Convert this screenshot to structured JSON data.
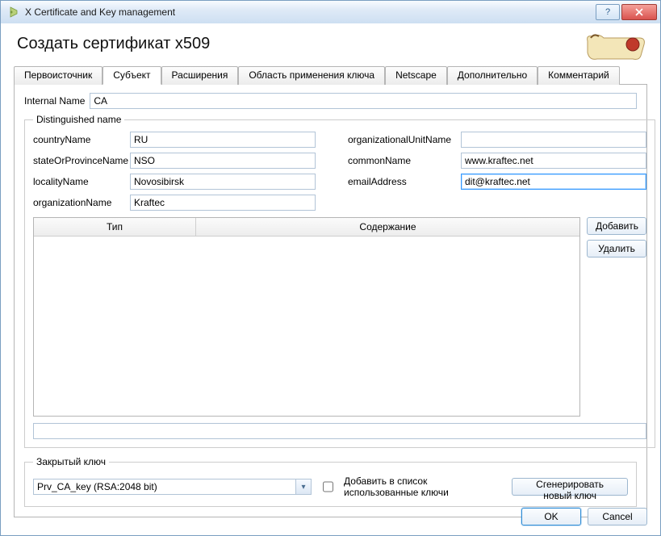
{
  "window": {
    "title": "X Certificate and Key management"
  },
  "page": {
    "title": "Создать сертификат x509"
  },
  "tabs": [
    {
      "label": "Первоисточник"
    },
    {
      "label": "Субъект"
    },
    {
      "label": "Расширения"
    },
    {
      "label": "Область применения ключа"
    },
    {
      "label": "Netscape"
    },
    {
      "label": "Дополнительно"
    },
    {
      "label": "Комментарий"
    }
  ],
  "internal": {
    "label": "Internal Name",
    "value": "CA"
  },
  "dn": {
    "legend": "Distinguished name",
    "countryName": {
      "label": "countryName",
      "value": "RU"
    },
    "stateOrProvinceName": {
      "label": "stateOrProvinceName",
      "value": "NSO"
    },
    "localityName": {
      "label": "localityName",
      "value": "Novosibirsk"
    },
    "organizationName": {
      "label": "organizationName",
      "value": "Kraftec"
    },
    "organizationalUnitName": {
      "label": "organizationalUnitName",
      "value": ""
    },
    "commonName": {
      "label": "commonName",
      "value": "www.kraftec.net"
    },
    "emailAddress": {
      "label": "emailAddress",
      "value": "dit@kraftec.net"
    }
  },
  "dn_table": {
    "col_type": "Тип",
    "col_content": "Содержание",
    "rows": []
  },
  "buttons": {
    "add": "Добавить",
    "delete": "Удалить",
    "ok": "OK",
    "cancel": "Cancel",
    "gen_key": "Сгенерировать новый ключ"
  },
  "private_key": {
    "legend": "Закрытый ключ",
    "selected": "Prv_CA_key (RSA:2048 bit)",
    "checkbox_label": "Добавить в список использованные ключи",
    "checked": false
  }
}
